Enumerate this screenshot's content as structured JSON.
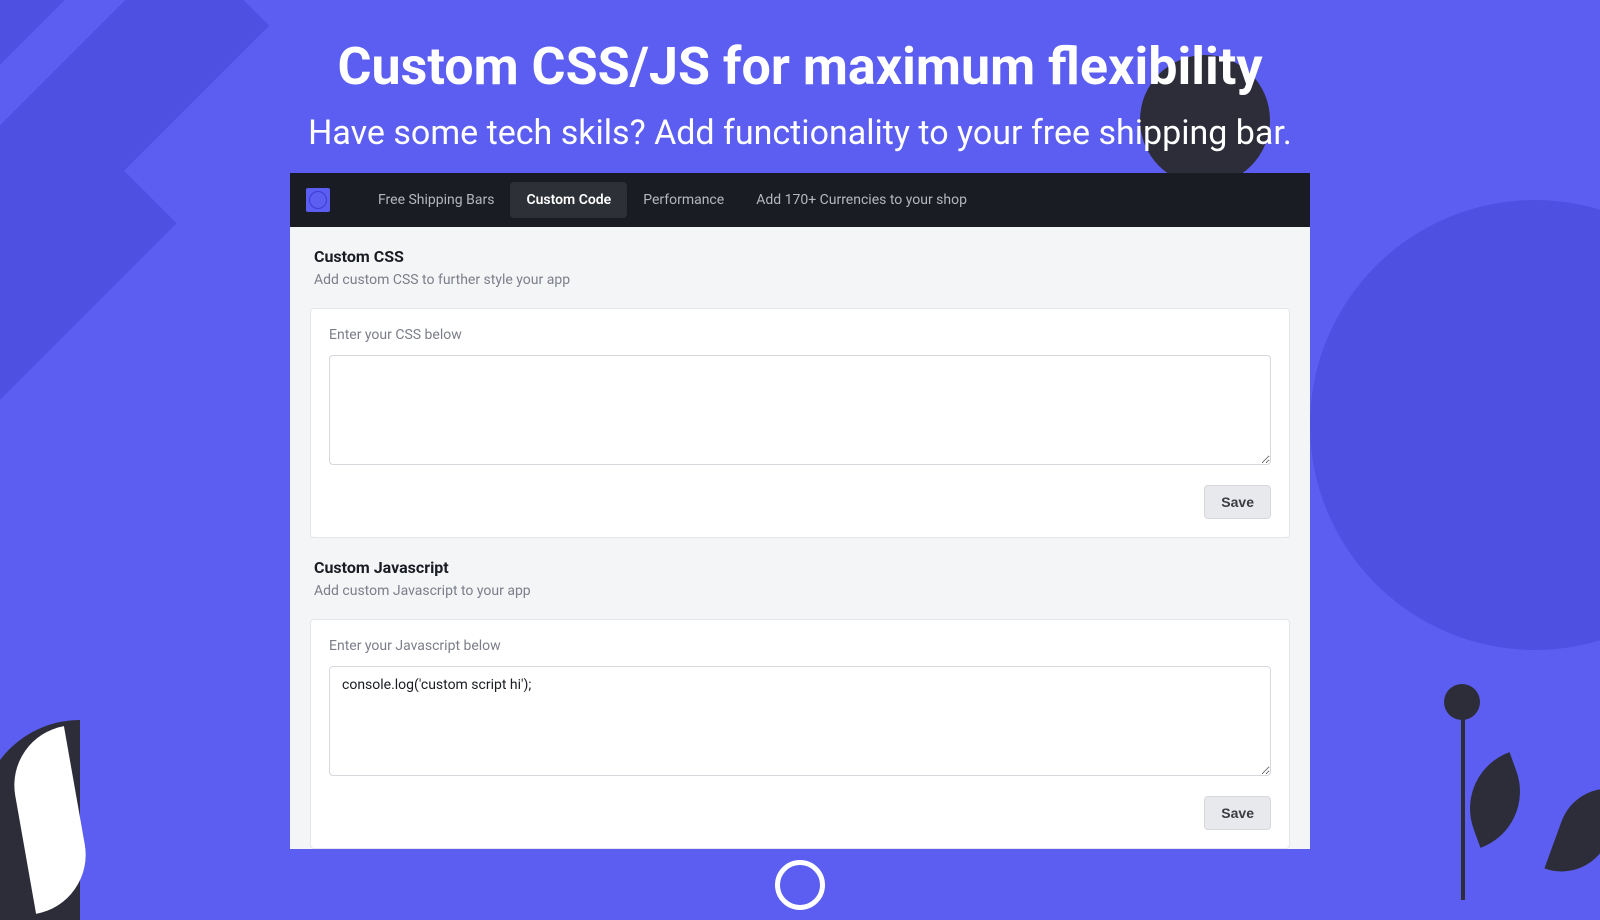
{
  "hero": {
    "title": "Custom CSS/JS for maximum flexibility",
    "subtitle": "Have some tech skils? Add functionality to your free shipping bar."
  },
  "nav": {
    "items": [
      {
        "label": "Free Shipping Bars",
        "active": false
      },
      {
        "label": "Custom Code",
        "active": true
      },
      {
        "label": "Performance",
        "active": false
      },
      {
        "label": "Add 170+ Currencies to your shop",
        "active": false
      }
    ]
  },
  "css_section": {
    "title": "Custom CSS",
    "description": "Add custom CSS to further style your app",
    "input_label": "Enter your CSS below",
    "value": "",
    "save_label": "Save"
  },
  "js_section": {
    "title": "Custom Javascript",
    "description": "Add custom Javascript to your app",
    "input_label": "Enter your Javascript below",
    "value": "console.log('custom script hi');",
    "save_label": "Save"
  }
}
